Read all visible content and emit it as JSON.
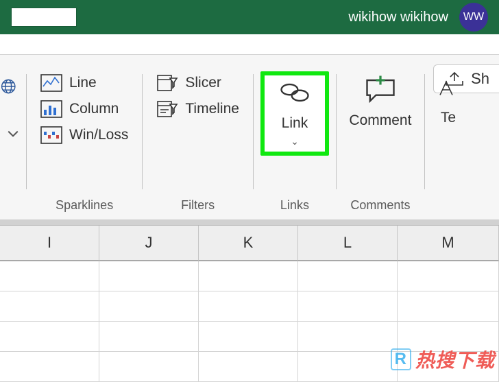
{
  "titlebar": {
    "username": "wikihow wikihow",
    "initials": "WW"
  },
  "share": {
    "label": "Sh"
  },
  "sparklines": {
    "line": "Line",
    "column": "Column",
    "winloss": "Win/Loss",
    "group": "Sparklines"
  },
  "filters": {
    "slicer": "Slicer",
    "timeline": "Timeline",
    "group": "Filters"
  },
  "links": {
    "link": "Link",
    "group": "Links"
  },
  "comments": {
    "comment": "Comment",
    "group": "Comments"
  },
  "text_partial": "Te",
  "columns": [
    "I",
    "J",
    "K",
    "L",
    "M"
  ],
  "watermark": {
    "r": "R",
    "zh": "热搜下载"
  }
}
